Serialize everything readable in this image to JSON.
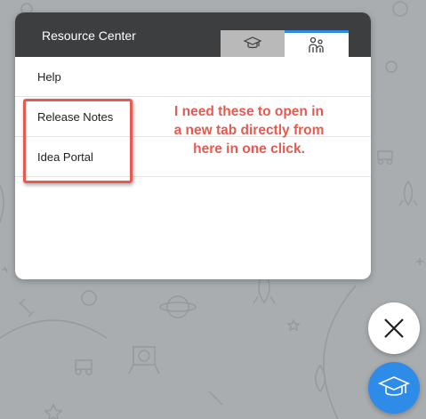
{
  "panel": {
    "title": "Resource Center",
    "tabs": [
      {
        "icon": "graduation-cap-icon",
        "active": false
      },
      {
        "icon": "people-icon",
        "active": true
      }
    ],
    "items": [
      {
        "label": "Help"
      },
      {
        "label": "Release Notes"
      },
      {
        "label": "Idea Portal"
      }
    ]
  },
  "annotation": {
    "lines": [
      "I need these to open in",
      "a new tab directly from",
      "here in one click."
    ],
    "color": "#e8594f"
  },
  "buttons": {
    "close_icon": "close-icon",
    "launcher_icon": "graduation-cap-icon"
  },
  "colors": {
    "header": "#3d3e40",
    "accent": "#2f8be8",
    "background": "#a9adb0"
  }
}
